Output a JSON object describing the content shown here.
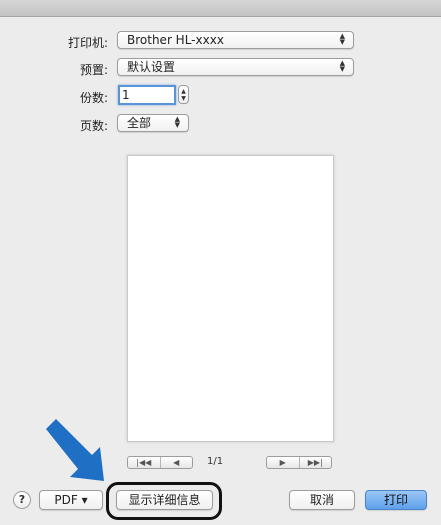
{
  "printer": {
    "label": "打印机:",
    "value": "Brother HL-xxxx"
  },
  "presets": {
    "label": "预置:",
    "value": "默认设置"
  },
  "copies": {
    "label": "份数:",
    "value": "1"
  },
  "pages": {
    "label": "页数:",
    "value": "全部"
  },
  "preview": {
    "page_indicator": "1/1",
    "nav_icons": [
      "first-page-icon",
      "previous-page-icon",
      "next-page-icon",
      "last-page-icon"
    ]
  },
  "footer": {
    "help_label": "?",
    "pdf_label": "PDF ▾",
    "show_details_label": "显示详细信息",
    "cancel_label": "取消",
    "print_label": "打印"
  },
  "colors": {
    "accent": "#5ea0ec",
    "annotation_arrow": "#1f6fc4",
    "background": "#ececec"
  }
}
